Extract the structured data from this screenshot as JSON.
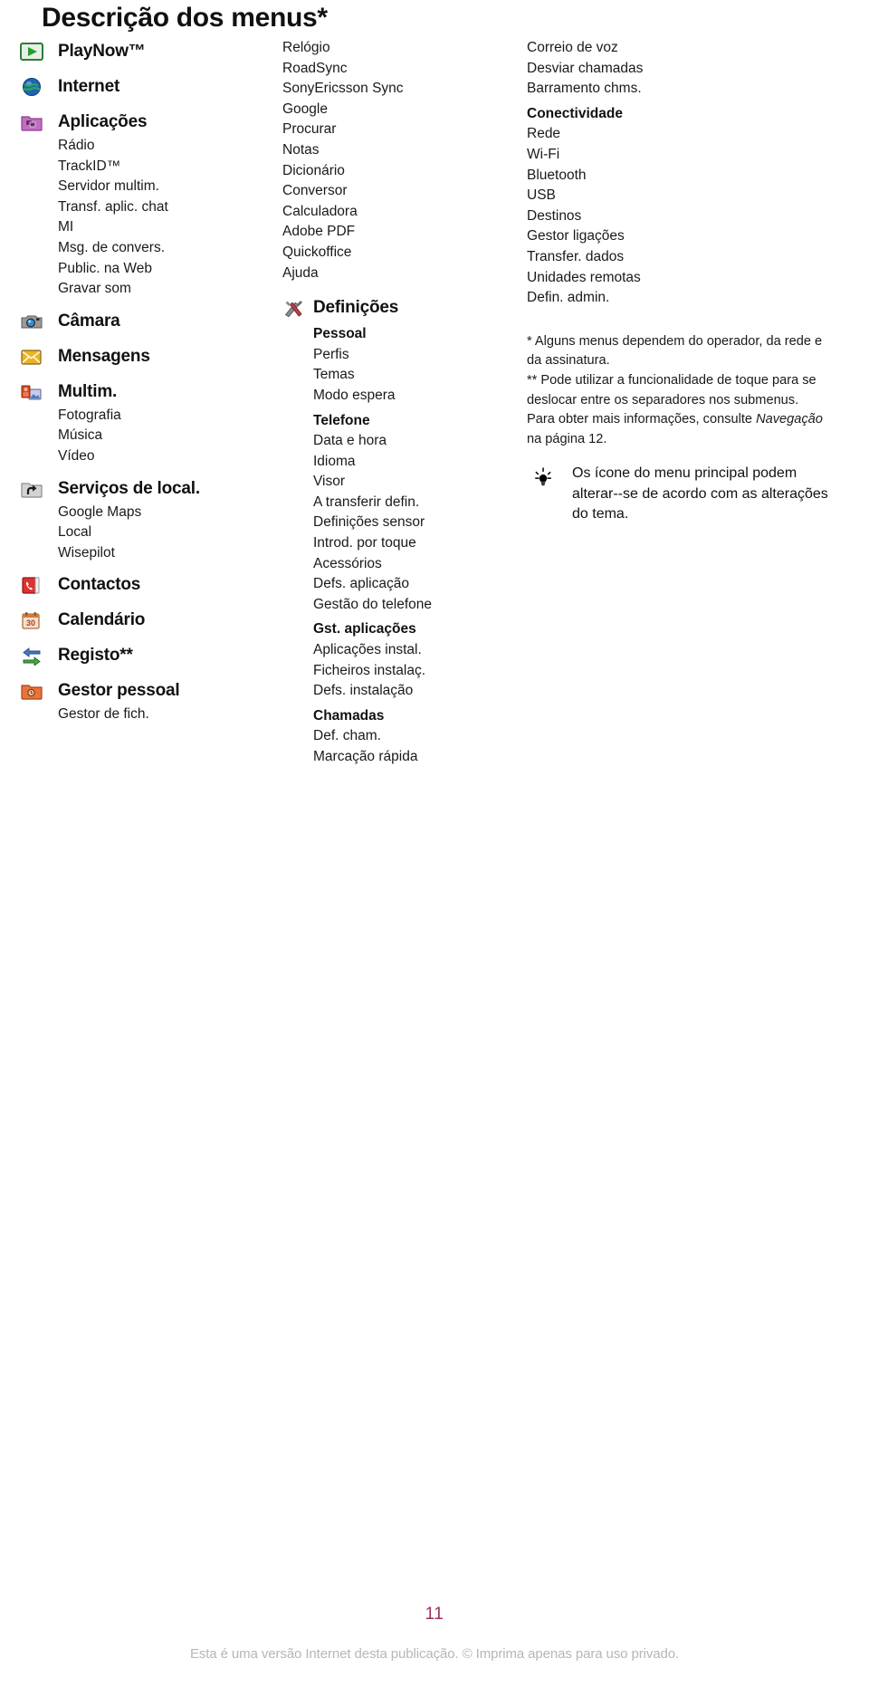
{
  "document": {
    "title": "Descrição dos menus*",
    "page_number": "11",
    "disclaimer": "Esta é uma versão Internet desta publicação. © Imprima apenas para uso privado."
  },
  "colors": {
    "page_number": "#9b2f62",
    "disclaimer": "#b6b6b6",
    "text": "#1a1a1a"
  },
  "column1": {
    "groups": [
      {
        "icon": "playnow-icon",
        "label": "PlayNow™",
        "items": []
      },
      {
        "icon": "internet-globe-icon",
        "label": "Internet",
        "items": []
      },
      {
        "icon": "applications-folder-icon",
        "label": "Aplicações",
        "items": [
          "Rádio",
          "TrackID™",
          "Servidor multim.",
          "Transf. aplic. chat",
          "MI",
          "Msg. de convers.",
          "Public. na Web",
          "Gravar som"
        ]
      },
      {
        "icon": "camera-icon",
        "label": "Câmara",
        "items": []
      },
      {
        "icon": "messages-envelope-icon",
        "label": "Mensagens",
        "items": []
      },
      {
        "icon": "multimedia-icon",
        "label": "Multim.",
        "items": [
          "Fotografia",
          "Música",
          "Vídeo"
        ]
      },
      {
        "icon": "location-services-folder-icon",
        "label": "Serviços de local.",
        "items": [
          "Google Maps",
          "Local",
          "Wisepilot"
        ]
      },
      {
        "icon": "contacts-icon",
        "label": "Contactos",
        "items": []
      },
      {
        "icon": "calendar-icon",
        "label": "Calendário",
        "items": []
      },
      {
        "icon": "call-log-arrows-icon",
        "label": "Registo**",
        "items": []
      },
      {
        "icon": "organiser-folder-icon",
        "label": "Gestor pessoal",
        "items": [
          "Gestor de fich."
        ]
      }
    ]
  },
  "column2": {
    "top_items": [
      "Relógio",
      "RoadSync",
      "SonyEricsson Sync",
      "Google",
      "Procurar",
      "Notas",
      "Dicionário",
      "Conversor",
      "Calculadora",
      "Adobe PDF",
      "Quickoffice",
      "Ajuda"
    ],
    "settings": {
      "icon": "settings-tools-icon",
      "label": "Definições",
      "items": [
        {
          "text": "Pessoal",
          "bold": true
        },
        {
          "text": "Perfis",
          "bold": false
        },
        {
          "text": "Temas",
          "bold": false
        },
        {
          "text": "Modo espera",
          "bold": false
        },
        {
          "text": "Telefone",
          "bold": true
        },
        {
          "text": "Data e hora",
          "bold": false
        },
        {
          "text": "Idioma",
          "bold": false
        },
        {
          "text": "Visor",
          "bold": false
        },
        {
          "text": "A transferir defin.",
          "bold": false
        },
        {
          "text": "Definições sensor",
          "bold": false
        },
        {
          "text": "Introd. por toque",
          "bold": false
        },
        {
          "text": "Acessórios",
          "bold": false
        },
        {
          "text": "Defs. aplicação",
          "bold": false
        },
        {
          "text": "Gestão do telefone",
          "bold": false
        },
        {
          "text": "Gst. aplicações",
          "bold": true
        },
        {
          "text": "Aplicações instal.",
          "bold": false
        },
        {
          "text": "Ficheiros instalaç.",
          "bold": false
        },
        {
          "text": "Defs. instalação",
          "bold": false
        },
        {
          "text": "Chamadas",
          "bold": true
        },
        {
          "text": "Def. cham.",
          "bold": false
        },
        {
          "text": "Marcação rápida",
          "bold": false
        }
      ]
    }
  },
  "column3": {
    "items": [
      {
        "text": "Correio de voz",
        "bold": false
      },
      {
        "text": "Desviar chamadas",
        "bold": false
      },
      {
        "text": "Barramento chms.",
        "bold": false
      },
      {
        "text": "Conectividade",
        "bold": true
      },
      {
        "text": "Rede",
        "bold": false
      },
      {
        "text": "Wi-Fi",
        "bold": false
      },
      {
        "text": "Bluetooth",
        "bold": false
      },
      {
        "text": "USB",
        "bold": false
      },
      {
        "text": "Destinos",
        "bold": false
      },
      {
        "text": "Gestor ligações",
        "bold": false
      },
      {
        "text": "Transfer. dados",
        "bold": false
      },
      {
        "text": "Unidades remotas",
        "bold": false
      },
      {
        "text": "Defin. admin.",
        "bold": false
      }
    ],
    "footnotes": {
      "single_star": "* Alguns menus dependem do operador, da rede e da assinatura.",
      "double_star_part1": "** Pode utilizar a funcionalidade de toque para se deslocar entre os separadores nos submenus. Para obter mais informações, consulte ",
      "double_star_italic": "Navegação",
      "double_star_part2": " na página 12."
    },
    "tip": {
      "icon": "lightbulb-tip-icon",
      "text": "Os ícone do menu principal podem alterar--se de acordo com as alterações do tema."
    }
  }
}
